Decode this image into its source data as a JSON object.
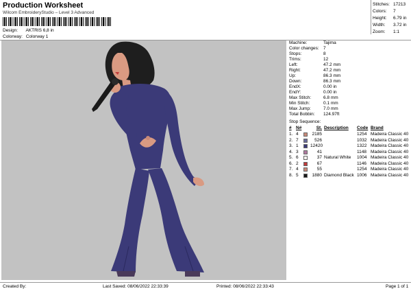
{
  "header": {
    "title": "Production Worksheet",
    "subtitle": "Wilcom EmbroideryStudio – Level 3 Advanced",
    "design_label": "Design:",
    "design_value": "AKTRIS 6,8 in",
    "colorway_label": "Colorway:",
    "colorway_value": "Colorway 1"
  },
  "stats": [
    {
      "k": "Stitches:",
      "v": "17213"
    },
    {
      "k": "Colors:",
      "v": "7"
    },
    {
      "k": "Height:",
      "v": "6.79 in"
    },
    {
      "k": "Width:",
      "v": "3.72 in"
    },
    {
      "k": "Zoom:",
      "v": "1:1"
    }
  ],
  "machine_info": [
    {
      "k": "Machine:",
      "v": "Tajima"
    },
    {
      "k": "Color changes:",
      "v": "7"
    },
    {
      "k": "Stops:",
      "v": "8"
    },
    {
      "k": "Trims:",
      "v": "12"
    },
    {
      "k": "Left:",
      "v": "47.2 mm"
    },
    {
      "k": "Right:",
      "v": "47.2 mm"
    },
    {
      "k": "Up:",
      "v": "86.3 mm"
    },
    {
      "k": "Down:",
      "v": "86.3 mm"
    },
    {
      "k": "EndX:",
      "v": "0.00 in"
    },
    {
      "k": "EndY:",
      "v": "0.00 in"
    },
    {
      "k": "Max Stitch:",
      "v": "6.8 mm"
    },
    {
      "k": "Min Stitch:",
      "v": "0.1 mm"
    },
    {
      "k": "Max Jump:",
      "v": "7.0 mm"
    },
    {
      "k": "Total Bobbin:",
      "v": "124.97ft"
    }
  ],
  "stop_sequence": {
    "title": "Stop Sequence:",
    "headers": {
      "num": "#",
      "n": "N#",
      "st": "St.",
      "desc": "Description",
      "code": "Code",
      "brand": "Brand"
    },
    "rows": [
      {
        "num": "1.",
        "n": "4",
        "color": "#c98a78",
        "st": "2185",
        "desc": "",
        "code": "1254",
        "brand": "Madeira Classic 40"
      },
      {
        "num": "2.",
        "n": "7",
        "color": "#6a6c9a",
        "st": "526",
        "desc": "",
        "code": "1032",
        "brand": "Madeira Classic 40"
      },
      {
        "num": "3.",
        "n": "1",
        "color": "#3b3a78",
        "st": "12420",
        "desc": "",
        "code": "1322",
        "brand": "Madeira Classic 40"
      },
      {
        "num": "4.",
        "n": "3",
        "color": "#b07aa0",
        "st": "41",
        "desc": "",
        "code": "1148",
        "brand": "Madeira Classic 40"
      },
      {
        "num": "5.",
        "n": "6",
        "color": "#f4f2ee",
        "st": "37",
        "desc": "Natural White",
        "code": "1004",
        "brand": "Madeira Classic 40"
      },
      {
        "num": "6.",
        "n": "2",
        "color": "#c23b3b",
        "st": "67",
        "desc": "",
        "code": "1146",
        "brand": "Madeira Classic 40"
      },
      {
        "num": "7.",
        "n": "4",
        "color": "#c98a78",
        "st": "55",
        "desc": "",
        "code": "1254",
        "brand": "Madeira Classic 40"
      },
      {
        "num": "8.",
        "n": "5",
        "color": "#1a1a1a",
        "st": "1880",
        "desc": "Diamond Black",
        "code": "1006",
        "brand": "Madeira Classic 40"
      }
    ]
  },
  "footer": {
    "created_by": "Created By:",
    "last_saved": "Last Saved: 08/06/2022 22:33:39",
    "printed": "Printed: 08/06/2022 22:33:43",
    "page": "Page 1 of 1"
  },
  "colors": {
    "background": "#c2c2c2",
    "suit": "#3b3a78",
    "hair": "#1e1e1e",
    "skin": "#d99a82"
  }
}
